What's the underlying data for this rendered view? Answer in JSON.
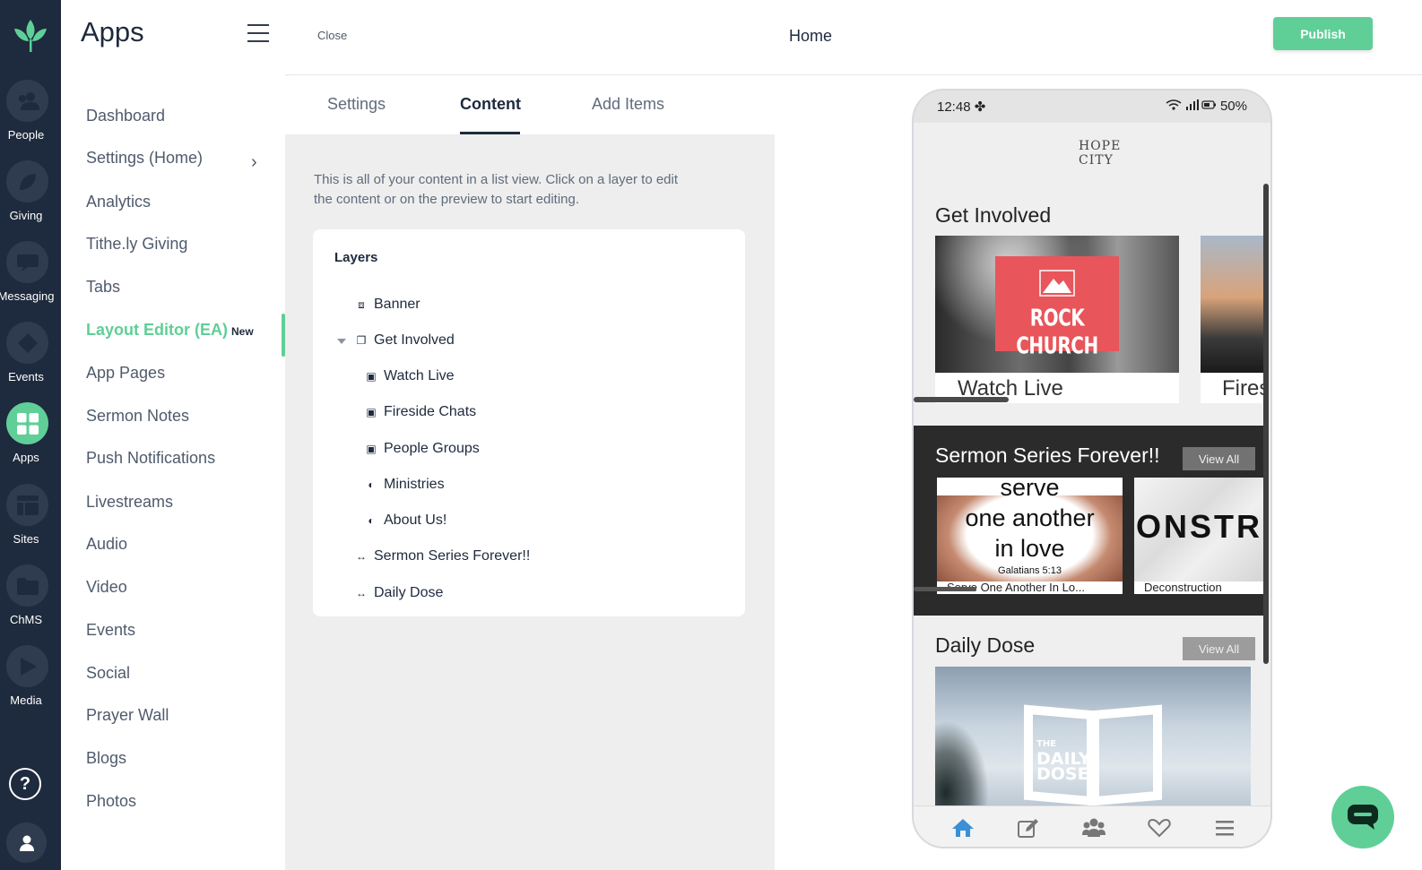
{
  "rail": {
    "logo_icon": "sprout-logo-icon",
    "items": [
      {
        "label": "People",
        "icon": "people-icon"
      },
      {
        "label": "Giving",
        "icon": "leaf-icon"
      },
      {
        "label": "Messaging",
        "icon": "chat-icon"
      },
      {
        "label": "Events",
        "icon": "ticket-icon"
      },
      {
        "label": "Apps",
        "icon": "apps-grid-icon"
      },
      {
        "label": "Sites",
        "icon": "layout-icon"
      },
      {
        "label": "ChMS",
        "icon": "folder-icon"
      },
      {
        "label": "Media",
        "icon": "play-icon"
      }
    ],
    "help": "?",
    "active_color": "#5fcf97"
  },
  "nav": {
    "title": "Apps",
    "items": [
      "Dashboard",
      "Settings (Home)",
      "Analytics",
      "Tithe.ly Giving",
      "Tabs",
      "Layout Editor (EA)",
      "App Pages",
      "Sermon Notes",
      "Push Notifications",
      "Livestreams",
      "Audio",
      "Video",
      "Events",
      "Social",
      "Prayer Wall",
      "Blogs",
      "Photos"
    ],
    "new_badge": "New",
    "active_item": "Layout Editor (EA)"
  },
  "topbar": {
    "close_label": "Close",
    "title": "Home",
    "publish_label": "Publish"
  },
  "editor": {
    "tabs": [
      "Settings",
      "Content",
      "Add Items"
    ],
    "active_tab": "Content",
    "description": "This is all of your content in a list view. Click on a layer to edit the content or on the preview to start editing.",
    "layers_title": "Layers",
    "layers": [
      {
        "label": "Banner",
        "icon": "banner-icon"
      },
      {
        "label": "Get Involved",
        "icon": "stack-icon"
      },
      {
        "label": "Watch Live",
        "icon": "card-icon"
      },
      {
        "label": "Fireside Chats",
        "icon": "card-icon"
      },
      {
        "label": "People Groups",
        "icon": "card-icon"
      },
      {
        "label": "Ministries",
        "icon": "globe-icon"
      },
      {
        "label": "About Us!",
        "icon": "globe-icon"
      },
      {
        "label": "Sermon Series Forever!!",
        "icon": "arrows-icon"
      },
      {
        "label": "Daily Dose",
        "icon": "arrows-icon"
      }
    ]
  },
  "preview": {
    "status_time": "12:48",
    "status_battery": "50%",
    "church_logo": "HOPE CITY",
    "section1": {
      "title": "Get Involved",
      "cards": [
        {
          "caption": "Watch Live",
          "image_text": "ROCK CHURCH"
        },
        {
          "caption": "Fires"
        }
      ]
    },
    "section2": {
      "title": "Sermon Series Forever!!",
      "view_all": "View All",
      "cards": [
        {
          "caption": "Serve One Another In Lo...",
          "image_lines": [
            "serve",
            "one another",
            "in love"
          ],
          "verse": "Galatians 5:13"
        },
        {
          "caption": "Deconstruction",
          "image_text": "ONSTRU"
        }
      ]
    },
    "section3": {
      "title": "Daily Dose",
      "view_all": "View All",
      "image_text_top": "THE",
      "image_text_mid": "DAILY",
      "image_text_bot": "DOSE"
    },
    "bottom_nav": [
      "home-icon",
      "edit-icon",
      "group-icon",
      "heart-icon",
      "menu-icon"
    ],
    "bottom_nav_active_color": "#3b8fd6"
  },
  "chat_button_icon": "chat-bubble-icon"
}
